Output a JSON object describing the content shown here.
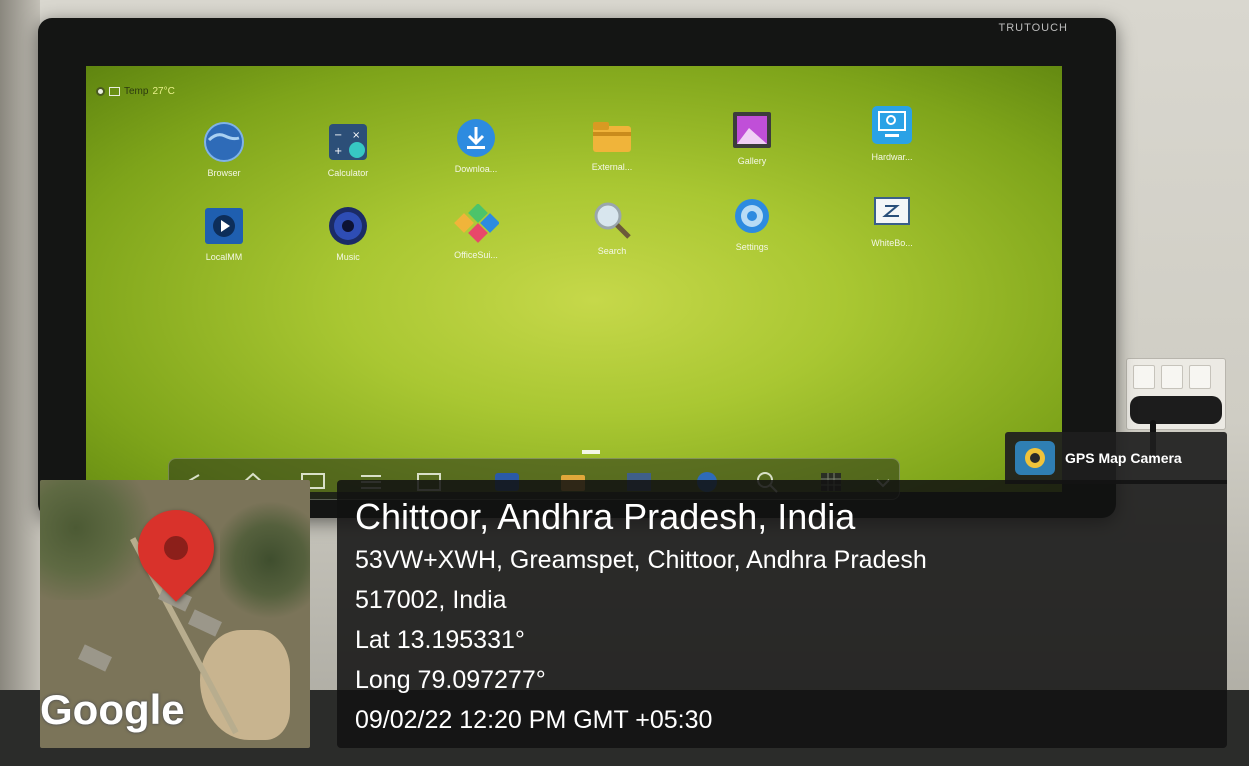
{
  "monitor": {
    "brand": "TRUTOUCH",
    "status": {
      "temp_label": "Temp",
      "temp_value": "27°C"
    },
    "apps": [
      {
        "label": "Browser",
        "icon": "globe-icon"
      },
      {
        "label": "Calculator",
        "icon": "calculator-icon"
      },
      {
        "label": "Downloa...",
        "icon": "download-icon"
      },
      {
        "label": "External...",
        "icon": "folder-icon"
      },
      {
        "label": "Gallery",
        "icon": "gallery-icon"
      },
      {
        "label": "Hardwar...",
        "icon": "hardware-icon"
      },
      {
        "label": "LocalMM",
        "icon": "media-player-icon"
      },
      {
        "label": "Music",
        "icon": "speaker-icon"
      },
      {
        "label": "OfficeSui...",
        "icon": "office-suite-icon"
      },
      {
        "label": "Search",
        "icon": "magnifier-icon"
      },
      {
        "label": "Settings",
        "icon": "gear-icon"
      },
      {
        "label": "WhiteBo...",
        "icon": "whiteboard-icon"
      }
    ],
    "dock_icons": [
      "back-icon",
      "home-icon",
      "screen-icon",
      "menu-icon",
      "whiteboard-icon",
      "hardware-icon",
      "folder-icon",
      "gallery-icon",
      "globe-icon",
      "magnifier-icon",
      "grid-icon",
      "chevron-down-icon"
    ]
  },
  "gps": {
    "app_name": "GPS Map Camera",
    "location_title": "Chittoor, Andhra Pradesh, India",
    "address_line1": "53VW+XWH, Greamspet, Chittoor, Andhra Pradesh",
    "address_line2": "517002, India",
    "lat": "Lat 13.195331°",
    "long": "Long 79.097277°",
    "datetime": "09/02/22 12:20 PM GMT +05:30",
    "map_logo": "Google"
  },
  "colors": {
    "screen_green": "#a9c732",
    "pin_red": "#d9322b",
    "overlay_dark": "#121212"
  }
}
